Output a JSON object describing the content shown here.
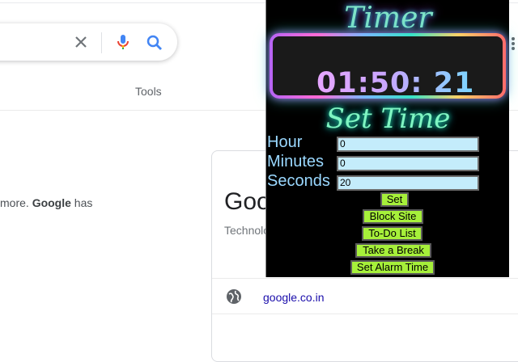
{
  "search": {
    "tools_label": "Tools"
  },
  "icons": {
    "clear": "close-icon",
    "mic": "mic-icon",
    "search": "search-icon",
    "globe": "globe-icon",
    "more": "more-vert-icon"
  },
  "result": {
    "snippet_pre": "more. ",
    "snippet_bold": "Google",
    "snippet_post": " has"
  },
  "knowledge_panel": {
    "title": "Goo",
    "subtitle": "Technolo",
    "site": "google.co.in"
  },
  "timer_popup": {
    "title": "Timer",
    "display": "01:50: 21",
    "set_time_heading": "Set Time",
    "fields": [
      {
        "label": "Hour",
        "value": "0"
      },
      {
        "label": "Minutes",
        "value": "0"
      },
      {
        "label": "Seconds",
        "value": "20"
      }
    ],
    "buttons": {
      "set": "Set",
      "block_site": "Block Site",
      "todo": "To-Do List",
      "take_break": "Take a Break",
      "alarm": "Set Alarm Time"
    },
    "colors": {
      "button_bg": "#a6f03a",
      "input_bg": "#c4ecfb",
      "label": "#9ad8ff"
    }
  }
}
